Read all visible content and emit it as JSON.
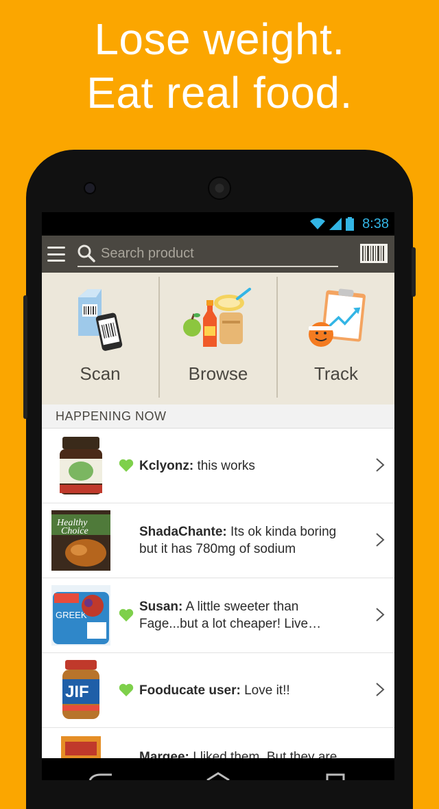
{
  "promo": {
    "line1": "Lose weight.",
    "line2": "Eat real food."
  },
  "status_bar": {
    "time": "8:38",
    "icons": [
      "wifi-icon",
      "signal-icon",
      "battery-icon"
    ]
  },
  "app_bar": {
    "menu_icon": "menu-icon",
    "search_placeholder": "Search product",
    "search_icon": "search-icon",
    "scan_icon": "barcode-icon"
  },
  "tiles": [
    {
      "label": "Scan",
      "icon": "scan-barcode-phone-icon"
    },
    {
      "label": "Browse",
      "icon": "groceries-icon"
    },
    {
      "label": "Track",
      "icon": "clipboard-chart-icon"
    }
  ],
  "feed": {
    "heading": "HAPPENING NOW",
    "items": [
      {
        "user": "Kclyonz:",
        "text": " this works",
        "liked": true,
        "thumb": "supplement-jar"
      },
      {
        "user": "ShadaChante:",
        "text": " Its ok kinda boring but it has 780mg of sodium",
        "liked": false,
        "thumb": "healthy-choice-meal"
      },
      {
        "user": "Susan:",
        "text": " A little sweeter than Fage...but a lot cheaper! Live…",
        "liked": true,
        "thumb": "greek-yogurt"
      },
      {
        "user": "Fooducate user:",
        "text": " Love it!!",
        "liked": true,
        "thumb": "jif-peanut-butter"
      },
      {
        "user": "Margee:",
        "text": " I liked them. But they are",
        "liked": false,
        "thumb": "snack-box"
      }
    ]
  },
  "colors": {
    "background": "#FBA600",
    "app_bar": "#4a4741",
    "tiles_bg": "#ece7da",
    "heart": "#7ed04b",
    "status_icons": "#33b5e5"
  }
}
